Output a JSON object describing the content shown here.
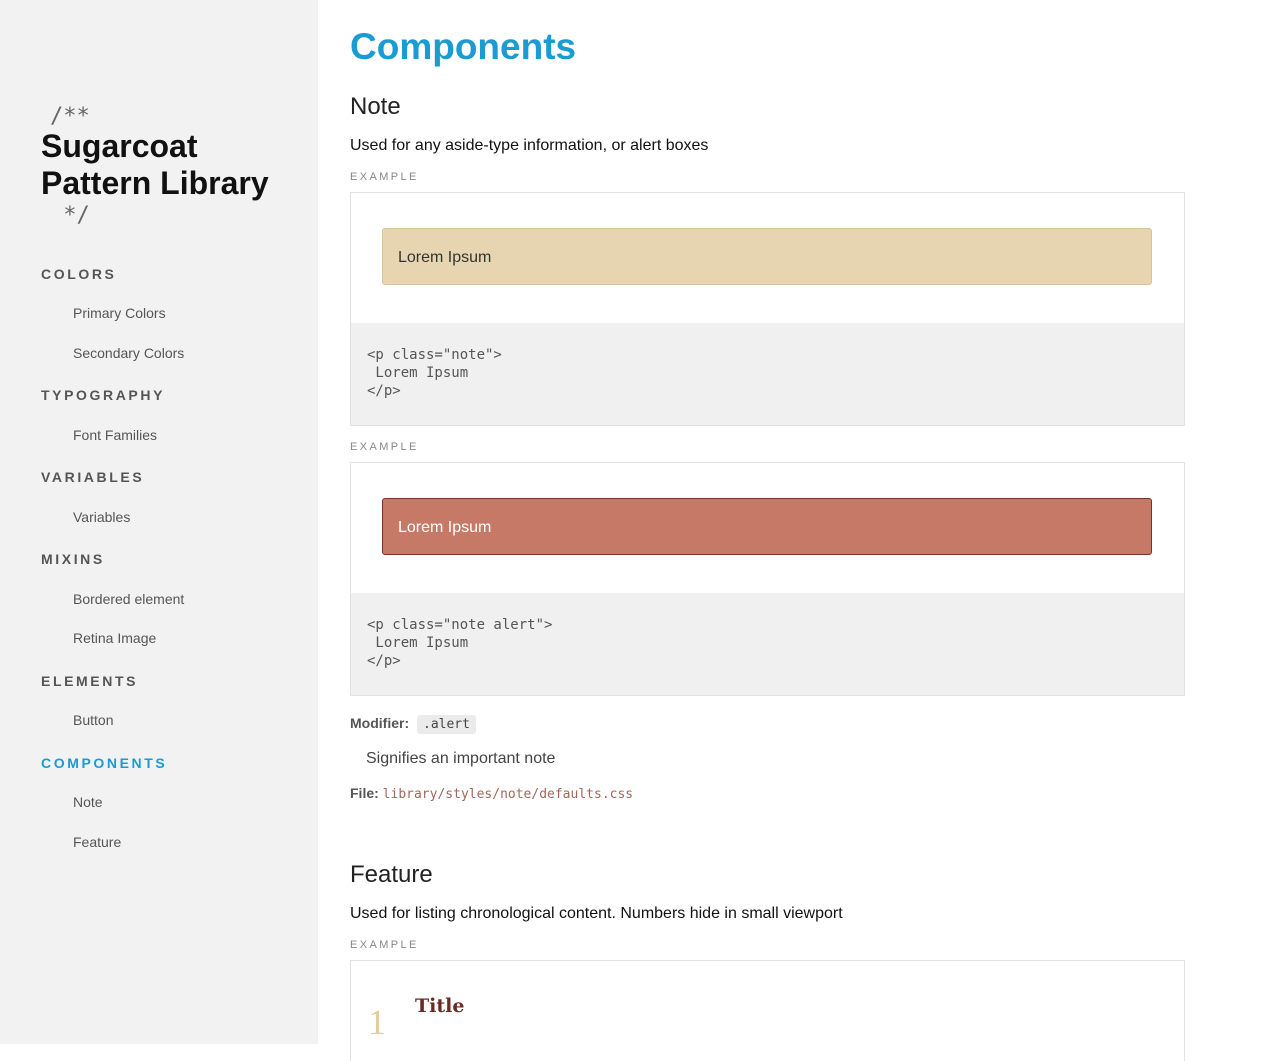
{
  "sidebar": {
    "logo_line1": "/**",
    "logo_line2": " */",
    "title": "Sugarcoat Pattern Library",
    "sections": [
      {
        "label": "COLORS",
        "items": [
          "Primary Colors",
          "Secondary Colors"
        ]
      },
      {
        "label": "TYPOGRAPHY",
        "items": [
          "Font Families"
        ]
      },
      {
        "label": "VARIABLES",
        "items": [
          "Variables"
        ]
      },
      {
        "label": "MIXINS",
        "items": [
          "Bordered element",
          "Retina Image"
        ]
      },
      {
        "label": "ELEMENTS",
        "items": [
          "Button"
        ]
      },
      {
        "label": "COMPONENTS",
        "items": [
          "Note",
          "Feature"
        ]
      }
    ],
    "active_section": "COMPONENTS"
  },
  "main": {
    "title": "Components",
    "note": {
      "title": "Note",
      "description": "Used for any aside-type information, or alert boxes",
      "examples": [
        {
          "label": "EXAMPLE",
          "preview_text": "Lorem Ipsum",
          "code": "<p class=\"note\">\n Lorem Ipsum\n</p>"
        },
        {
          "label": "EXAMPLE",
          "preview_text": "Lorem Ipsum",
          "code": "<p class=\"note alert\">\n Lorem Ipsum\n</p>"
        }
      ],
      "modifier_label": "Modifier:",
      "modifier_value": ".alert",
      "modifier_desc": "Signifies an important note",
      "file_label": "File:",
      "file_path": "library/styles/note/defaults.css"
    },
    "feature": {
      "title": "Feature",
      "description": "Used for listing chronological content. Numbers hide in small viewport",
      "example_label": "EXAMPLE",
      "number": "1",
      "item_title": "Title"
    }
  },
  "colors": {
    "accent": "#1a9bd1",
    "note_bg": "#e6d5b0",
    "alert_bg": "#c77967",
    "sidebar_bg": "#f2f2f2"
  }
}
